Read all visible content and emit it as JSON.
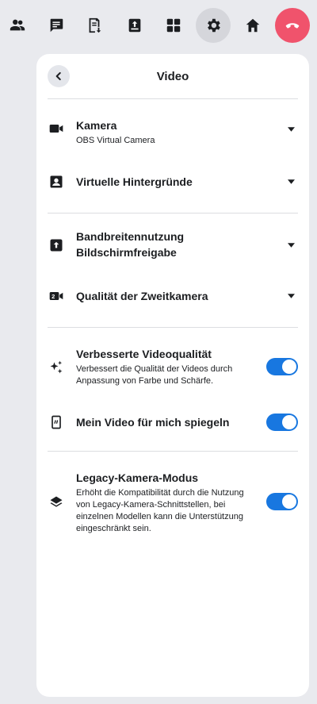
{
  "toolbar": {
    "buttons": [
      {
        "icon": "people-icon"
      },
      {
        "icon": "chat-icon"
      },
      {
        "icon": "notes-icon"
      },
      {
        "icon": "share-icon"
      },
      {
        "icon": "apps-icon"
      },
      {
        "icon": "gear-icon"
      },
      {
        "icon": "home-icon"
      },
      {
        "icon": "hangup-icon"
      }
    ],
    "active_button": "gear-icon",
    "hangup_color": "#f0536c"
  },
  "panel": {
    "title": "Video",
    "sections": {
      "camera": {
        "title": "Kamera",
        "subtitle": "OBS Virtual Camera"
      },
      "backgrounds": {
        "title": "Virtuelle Hintergründe"
      },
      "bandwidth": {
        "title_line1": "Bandbreitennutzung",
        "title_line2": "Bildschirmfreigabe"
      },
      "second_camera": {
        "title": "Qualität der Zweitkamera"
      },
      "enhanced": {
        "title": "Verbesserte Videoqualität",
        "description": "Verbessert die Qualität der Videos durch Anpassung von Farbe und Schärfe.",
        "enabled": true
      },
      "mirror": {
        "title": "Mein Video für mich spiegeln",
        "enabled": true
      },
      "legacy": {
        "title": "Legacy-Kamera-Modus",
        "description": "Erhöht die Kompatibilität durch die Nutzung von Legacy-Kamera-Schnittstellen, bei einzelnen Modellen kann die Unterstützung eingeschränkt sein.",
        "enabled": true
      }
    }
  },
  "colors": {
    "background": "#e9eaee",
    "toggle_on": "#1877e0",
    "text": "#1c1e21"
  }
}
